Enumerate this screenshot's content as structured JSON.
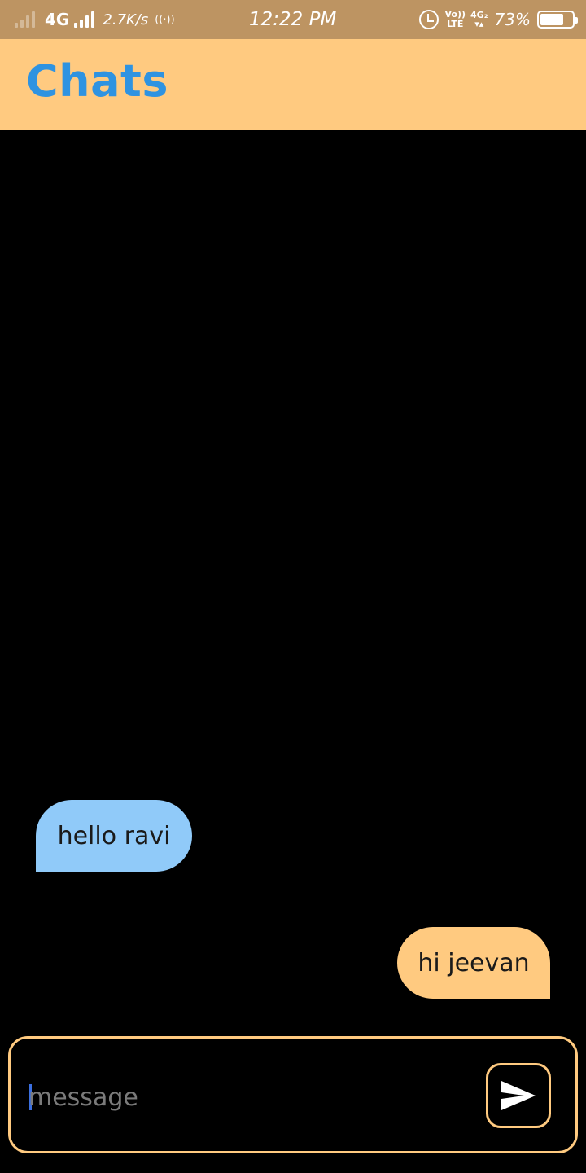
{
  "status_bar": {
    "network_type": "4G",
    "data_speed": "2.7K/s",
    "time": "12:22 PM",
    "volte_top": "Vo))",
    "volte_bottom": "LTE",
    "net2_top": "4G₂",
    "net2_bottom": "▾▴",
    "battery_percent": "73%",
    "battery_level": 0.73,
    "icons": [
      "signal-weak-icon",
      "signal-strong-icon",
      "hotspot-icon",
      "alarm-icon",
      "battery-icon"
    ]
  },
  "header": {
    "title": "Chats"
  },
  "messages": [
    {
      "direction": "incoming",
      "text": "hello ravi"
    },
    {
      "direction": "outgoing",
      "text": "hi jeevan"
    }
  ],
  "composer": {
    "placeholder": "message",
    "value": "",
    "send_icon": "send-icon"
  },
  "colors": {
    "status_bar_bg": "#bd9462",
    "app_bar_bg": "#ffca80",
    "title_color": "#2f93e1",
    "incoming_bubble": "#90caf9",
    "outgoing_bubble": "#ffca80",
    "background": "#000000"
  }
}
